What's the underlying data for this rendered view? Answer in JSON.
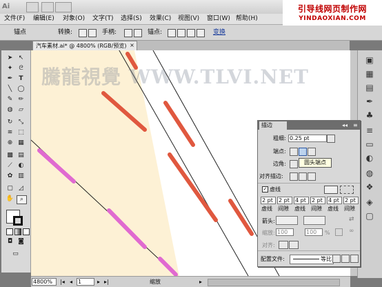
{
  "app": {
    "logo": "Ai"
  },
  "banner": {
    "cn": "引导线网页制作网",
    "en": "YINDAOXIAN.COM"
  },
  "menu": [
    "文件(F)",
    "编辑(E)",
    "对象(O)",
    "文字(T)",
    "选择(S)",
    "效果(C)",
    "视图(V)",
    "窗口(W)",
    "帮助(H)"
  ],
  "control": {
    "anchor_label": "锚点",
    "convert_label": "转换:",
    "handles_label": "手柄:",
    "anchor2_label": "锚点:",
    "extra_label": "变换"
  },
  "document": {
    "tab_title": "汽车素材.ai* @ 4800% (RGB/预览)"
  },
  "watermark": "騰龍視覺 WWW.TLVI.NET",
  "status": {
    "zoom": "4800%",
    "page": "1",
    "tool": "缩放"
  },
  "stroke_panel": {
    "title": "描边",
    "weight_label": "粗细:",
    "weight_value": "0.25 pt",
    "cap_label": "端点:",
    "corner_label": "边角:",
    "align_label": "对齐描边:",
    "tooltip": "圆头端点",
    "dashed_label": "虚线",
    "dash_values": [
      "2 pt",
      "2 pt",
      "4 pt",
      "2 pt",
      "4 pt",
      "2 pt"
    ],
    "dash_labels": [
      "虚线",
      "间隙",
      "虚线",
      "间隙",
      "虚线",
      "间隙"
    ],
    "arrow_label": "箭头:",
    "scale_label": "缩放:",
    "scale_values": [
      "100",
      "100"
    ],
    "scale_unit": "%",
    "align2_label": "对齐:",
    "profile_label": "配置文件:",
    "profile_value": "等比"
  },
  "colors": {
    "dash_red": "#e0583f",
    "dash_pink": "#e06ad0",
    "cream": "#fdf1d5",
    "banner_red": "#c00000"
  }
}
